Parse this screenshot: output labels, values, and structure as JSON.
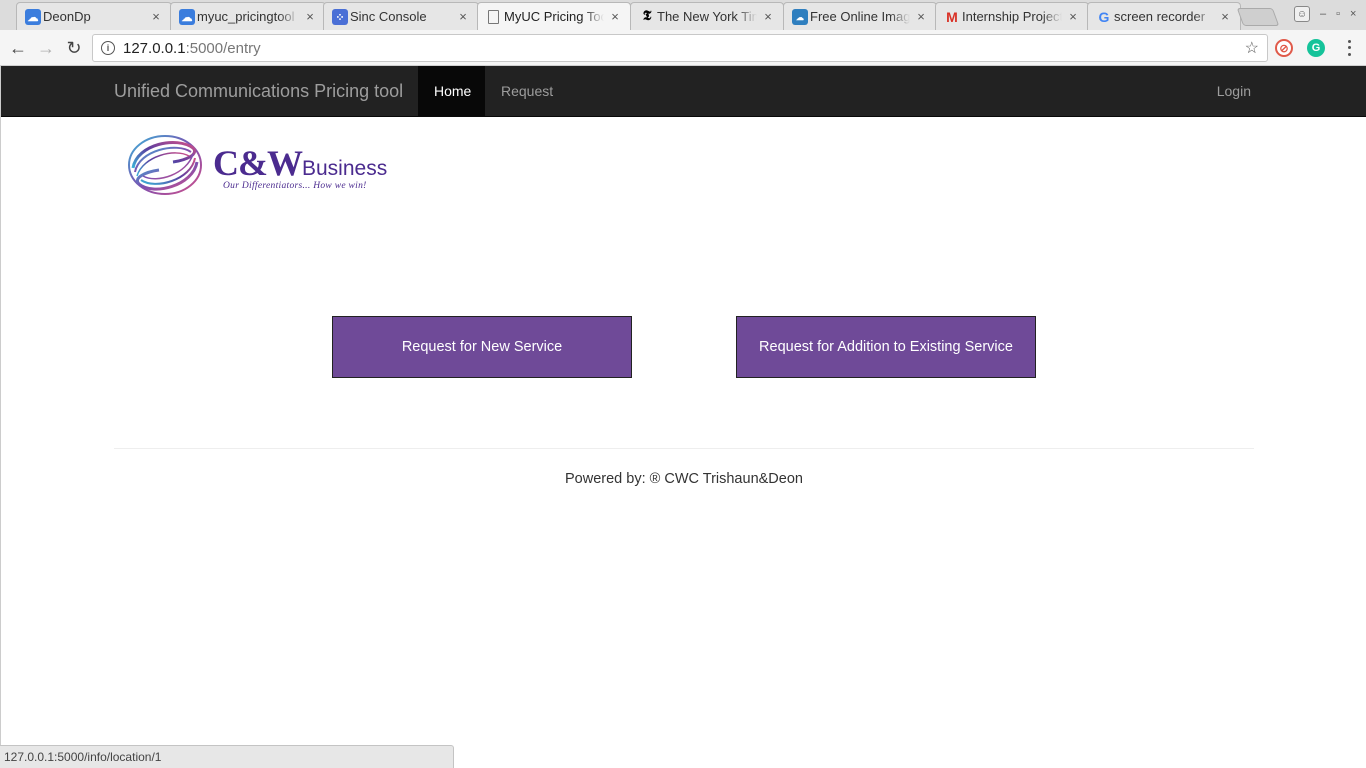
{
  "browser": {
    "tabs": [
      {
        "title": "DeonDp",
        "icon": "cloud-drive-icon",
        "color": "#3b7ddd",
        "active": false
      },
      {
        "title": "myuc_pricingtool",
        "icon": "cloud-drive-icon",
        "color": "#3b7ddd",
        "active": false
      },
      {
        "title": "Sinc Console",
        "icon": "sinc-icon",
        "color": "#4a6fd6",
        "active": false
      },
      {
        "title": "MyUC Pricing Tool",
        "icon": "page-icon",
        "color": "#777777",
        "active": true
      },
      {
        "title": "The New York Times",
        "icon": "nyt-icon",
        "color": "#000000",
        "active": false
      },
      {
        "title": "Free Online Image",
        "icon": "image-editor-icon",
        "color": "#2f7fbf",
        "active": false
      },
      {
        "title": "Internship Project",
        "icon": "gmail-icon",
        "color": "#d93025",
        "active": false
      },
      {
        "title": "screen recorder",
        "icon": "google-icon",
        "color": "#4285f4",
        "active": false
      }
    ],
    "close_glyph": "×",
    "url_host": "127.0.0.1",
    "url_path": ":5000/entry",
    "status_url": "127.0.0.1:5000/info/location/1",
    "window_controls": {
      "minimize": "–",
      "maximize": "▫",
      "close": "×"
    }
  },
  "navbar": {
    "brand": "Unified Communications Pricing tool",
    "items": [
      {
        "label": "Home",
        "active": true
      },
      {
        "label": "Request",
        "active": false
      }
    ],
    "login": "Login"
  },
  "logo": {
    "brand_mark": "C&W",
    "brand_word": "Business",
    "tagline": "Our Differentiators... How we win!"
  },
  "actions": {
    "new_service": "Request for New Service",
    "addition_service": "Request for Addition to Existing Service"
  },
  "footer": {
    "text": "Powered by: ® CWC Trishaun&Deon"
  },
  "colors": {
    "navbar_bg": "#222222",
    "button_purple": "#6f4a98",
    "logo_purple": "#4b2b8f"
  }
}
